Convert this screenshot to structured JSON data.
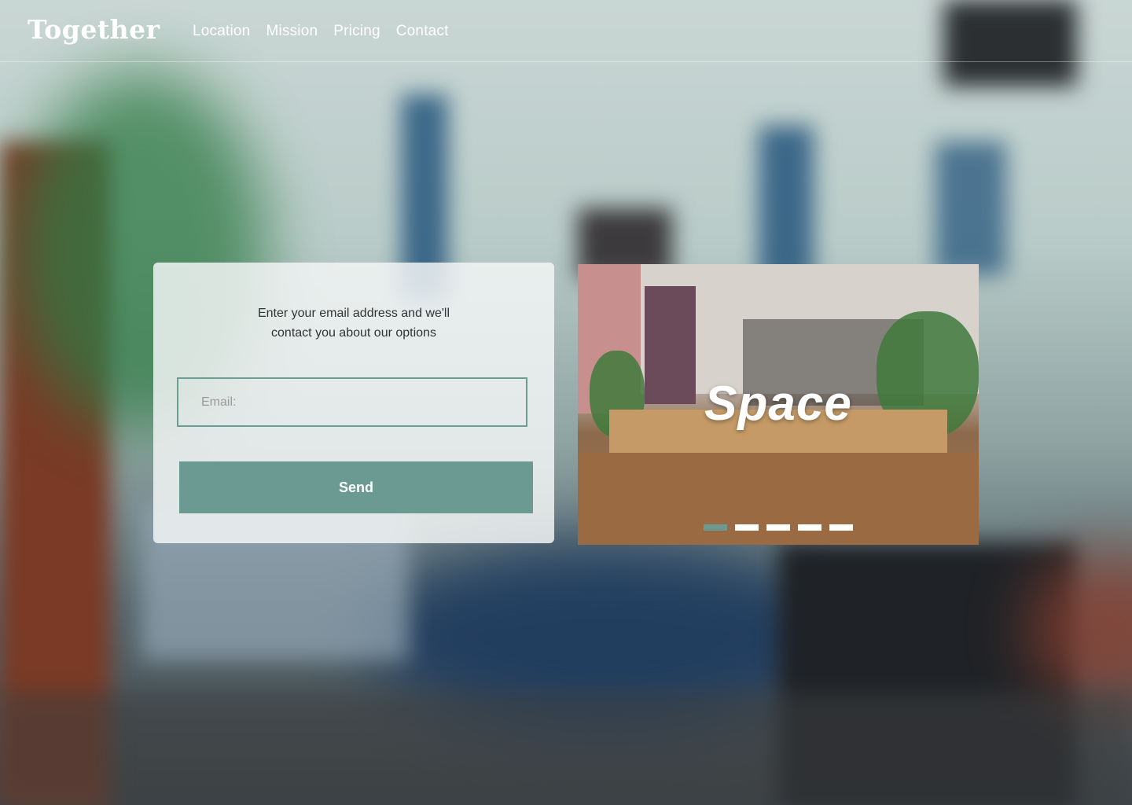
{
  "header": {
    "logo": "Together",
    "nav": [
      {
        "label": "Location"
      },
      {
        "label": "Mission"
      },
      {
        "label": "Pricing"
      },
      {
        "label": "Contact"
      }
    ]
  },
  "form": {
    "message": "Enter your email address and we'll contact you about our options",
    "email_placeholder": "Email:",
    "send_label": "Send"
  },
  "slider": {
    "title": "Space",
    "slide_count": 5,
    "active_slide": 1
  },
  "colors": {
    "accent": "#6b9a92",
    "text_light": "#ffffff",
    "card_background": "#f3f5f5"
  }
}
